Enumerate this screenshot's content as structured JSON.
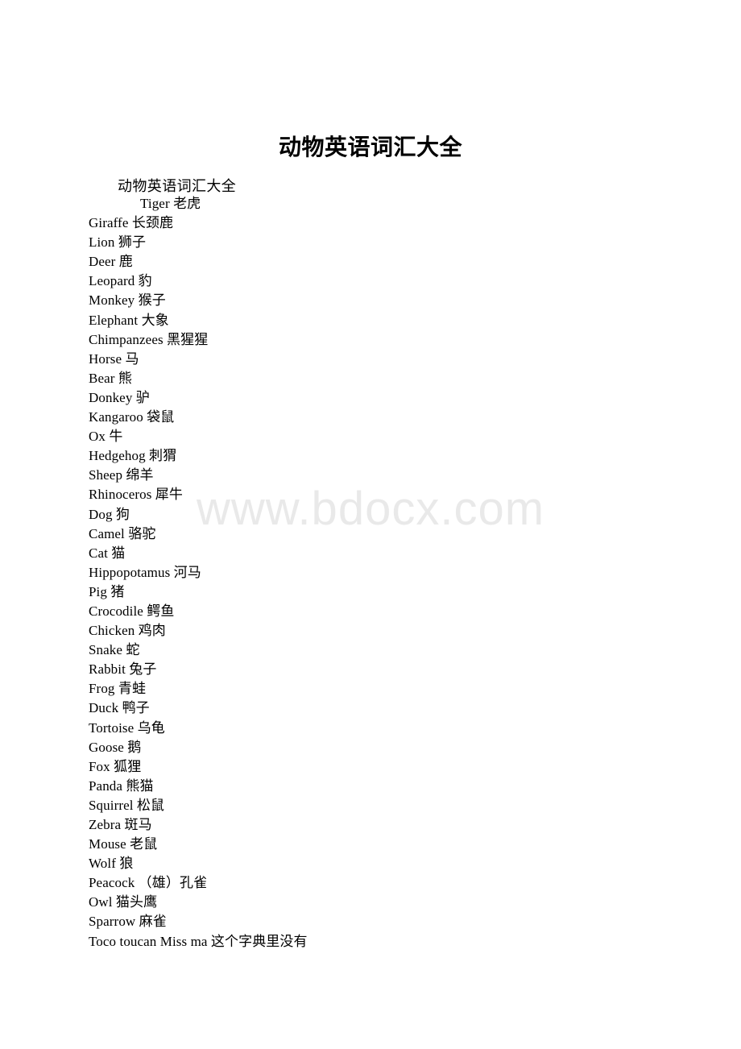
{
  "document": {
    "title": "动物英语词汇大全",
    "subtitle": "动物英语词汇大全",
    "watermark": "www.bdocx.com",
    "watermark_color": "#e9e9e9",
    "text_color": "#000000",
    "background_color": "#ffffff"
  },
  "vocabulary": [
    {
      "text": "Tiger 老虎",
      "indented": true
    },
    {
      "text": "Giraffe 长颈鹿",
      "indented": false
    },
    {
      "text": "Lion 狮子",
      "indented": false
    },
    {
      "text": "Deer 鹿",
      "indented": false
    },
    {
      "text": "Leopard 豹",
      "indented": false
    },
    {
      "text": "Monkey 猴子",
      "indented": false
    },
    {
      "text": "Elephant 大象",
      "indented": false
    },
    {
      "text": "Chimpanzees 黑猩猩",
      "indented": false
    },
    {
      "text": "Horse 马",
      "indented": false
    },
    {
      "text": "Bear 熊",
      "indented": false
    },
    {
      "text": "Donkey 驴",
      "indented": false
    },
    {
      "text": "Kangaroo 袋鼠",
      "indented": false
    },
    {
      "text": "Ox 牛",
      "indented": false
    },
    {
      "text": "Hedgehog 刺猬",
      "indented": false
    },
    {
      "text": "Sheep 绵羊",
      "indented": false
    },
    {
      "text": "Rhinoceros 犀牛",
      "indented": false
    },
    {
      "text": "Dog 狗",
      "indented": false
    },
    {
      "text": "Camel 骆驼",
      "indented": false
    },
    {
      "text": "Cat 猫",
      "indented": false
    },
    {
      "text": "Hippopotamus 河马",
      "indented": false
    },
    {
      "text": "Pig 猪",
      "indented": false
    },
    {
      "text": "Crocodile 鳄鱼",
      "indented": false
    },
    {
      "text": "Chicken 鸡肉",
      "indented": false
    },
    {
      "text": "Snake 蛇",
      "indented": false
    },
    {
      "text": "Rabbit 兔子",
      "indented": false
    },
    {
      "text": "Frog 青蛙",
      "indented": false
    },
    {
      "text": "Duck 鸭子",
      "indented": false
    },
    {
      "text": "Tortoise 乌龟",
      "indented": false
    },
    {
      "text": "Goose 鹅",
      "indented": false
    },
    {
      "text": "Fox 狐狸",
      "indented": false
    },
    {
      "text": "Panda 熊猫",
      "indented": false
    },
    {
      "text": "Squirrel 松鼠",
      "indented": false
    },
    {
      "text": "Zebra 斑马",
      "indented": false
    },
    {
      "text": "Mouse 老鼠",
      "indented": false
    },
    {
      "text": "Wolf 狼",
      "indented": false
    },
    {
      "text": "Peacock （雄）孔雀",
      "indented": false
    },
    {
      "text": "Owl 猫头鹰",
      "indented": false
    },
    {
      "text": "Sparrow 麻雀",
      "indented": false
    },
    {
      "text": "Toco toucan Miss ma 这个字典里没有",
      "indented": false
    }
  ]
}
